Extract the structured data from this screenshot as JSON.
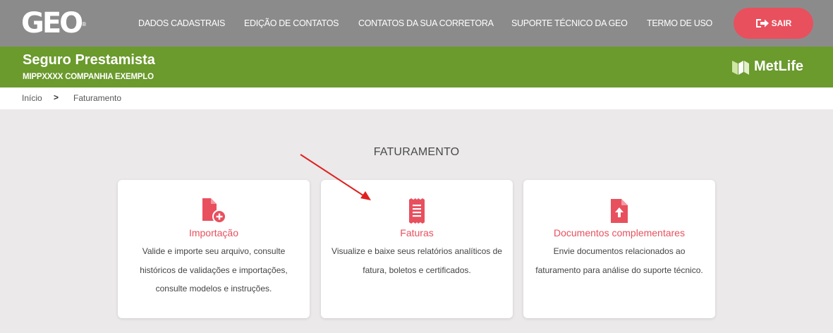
{
  "header": {
    "logo": "GEO",
    "logo_mark": "®",
    "nav": [
      "DADOS CADASTRAIS",
      "EDIÇÃO DE CONTATOS",
      "CONTATOS DA SUA CORRETORA",
      "SUPORTE TÉCNICO DA GEO",
      "TERMO DE USO"
    ],
    "logout_label": "SAIR",
    "logout_icon": "sign-out-icon"
  },
  "banner": {
    "title": "Seguro Prestamista",
    "policy_code": "MIPPXXXX",
    "company": " COMPANHIA EXEMPLO",
    "brand": "MetLife",
    "brand_icon": "metlife-logo-icon"
  },
  "breadcrumb": {
    "items": [
      "Início",
      "Faturamento"
    ],
    "separator": ">"
  },
  "main": {
    "title": "FATURAMENTO",
    "cards": [
      {
        "title": "Importação",
        "icon": "file-plus-icon",
        "description": "Valide e importe seu arquivo, consulte históricos de validações e importações, consulte modelos e instruções."
      },
      {
        "title": "Faturas",
        "icon": "receipt-icon",
        "description": "Visualize e baixe seus relatórios analíticos de fatura, boletos e certificados."
      },
      {
        "title": "Documentos complementares",
        "icon": "file-upload-icon",
        "description": "Envie documentos relacionados ao faturamento para análise do suporte técnico."
      }
    ]
  },
  "colors": {
    "topbar": "#8c8b8c",
    "banner": "#6b9a2d",
    "accent": "#e8505e",
    "annotation_arrow": "#e02020"
  }
}
